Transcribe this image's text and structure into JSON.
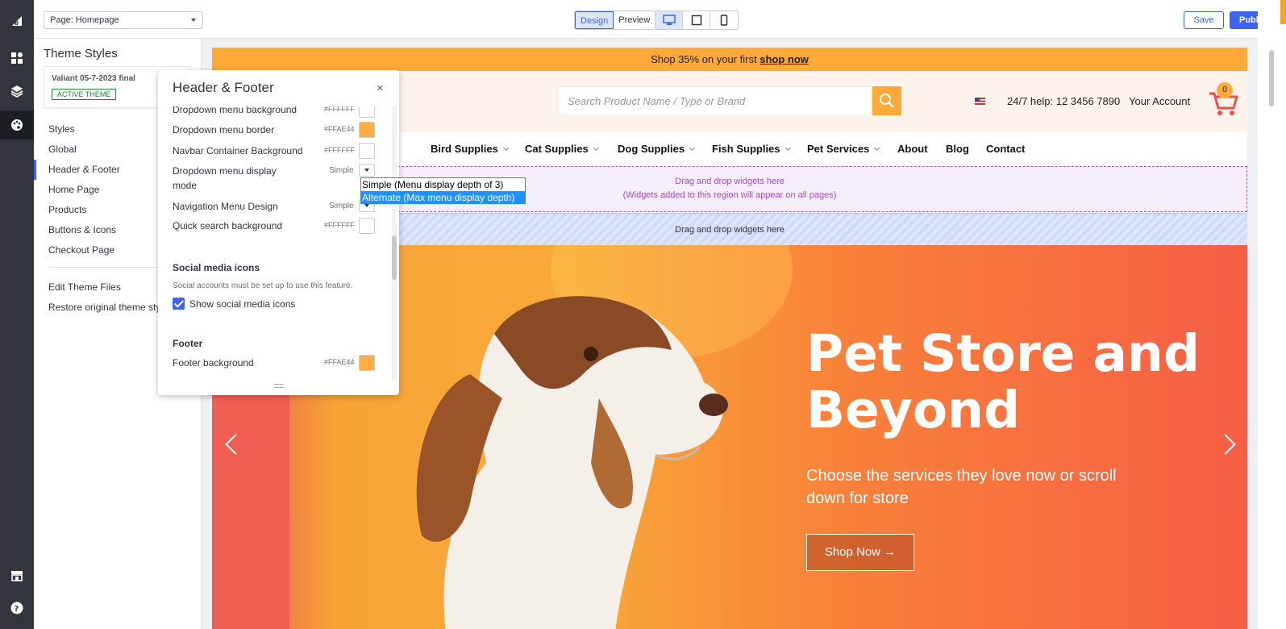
{
  "app": {
    "page_select": "Page: Homepage",
    "mode_design": "Design",
    "mode_preview": "Preview",
    "save_label": "Save",
    "publish_label": "Publish",
    "accent": "#3c64f4"
  },
  "sidebar": {
    "title": "Theme Styles",
    "theme_name": "Valiant 05-7-2023 final",
    "theme_badge": "ACTIVE THEME",
    "items": [
      {
        "label": "Styles"
      },
      {
        "label": "Global"
      },
      {
        "label": "Header & Footer"
      },
      {
        "label": "Home Page"
      },
      {
        "label": "Products"
      },
      {
        "label": "Buttons & Icons"
      },
      {
        "label": "Checkout Page"
      }
    ],
    "links": [
      {
        "label": "Edit Theme Files"
      },
      {
        "label": "Restore original theme styles"
      }
    ]
  },
  "editor": {
    "title": "Header & Footer",
    "close": "×",
    "rows": [
      {
        "label": "Dropdown menu background",
        "hex": "#FFFFFF",
        "color": "#FFFFFF"
      },
      {
        "label": "Dropdown menu border",
        "hex": "#FFAE44",
        "color": "#FFAE44"
      },
      {
        "label": "Navbar Container Background",
        "hex": "#FFFFFF",
        "color": "#FFFFFF"
      }
    ],
    "display_mode": {
      "label_line1": "Dropdown menu display",
      "label_line2": "mode",
      "value": "Simple"
    },
    "nav_design": {
      "label": "Navigation Menu Design",
      "value": "Simple"
    },
    "quick_search": {
      "label": "Quick search background",
      "hex": "#FFFFFF",
      "color": "#FFFFFF"
    },
    "social_title": "Social media icons",
    "social_note": "Social accounts must be set up to use this feature.",
    "social_checkbox": "Show social media icons",
    "footer_title": "Footer",
    "footer_bg": {
      "label": "Footer background",
      "hex": "#FFAE44",
      "color": "#FFAE44"
    }
  },
  "dropdown": {
    "options": [
      "Simple (Menu display depth of 3)",
      "Alternate (Max menu display depth)"
    ]
  },
  "store": {
    "promo_text": "Shop 35% on your first ",
    "promo_link": "shop now",
    "search_placeholder": "Search Product Name / Type or Brand",
    "help": "24/7 help: 12 3456 7890",
    "account": "Your Account",
    "cart_count": "0",
    "nav": [
      "Bird Supplies",
      "Cat Supplies",
      "Dog Supplies",
      "Fish Supplies",
      "Pet Services",
      "About",
      "Blog",
      "Contact"
    ],
    "dropzone_line1": "Drag and drop widgets here",
    "dropzone_line2": "(Widgets added to this region will appear on all pages)",
    "dropzone2": "Drag and drop widgets here",
    "hero_title": "Pet Store and Beyond",
    "hero_sub": "Choose the services they love now or scroll down for store",
    "hero_button": "Shop Now →",
    "brand_orange": "#feaa3b"
  }
}
